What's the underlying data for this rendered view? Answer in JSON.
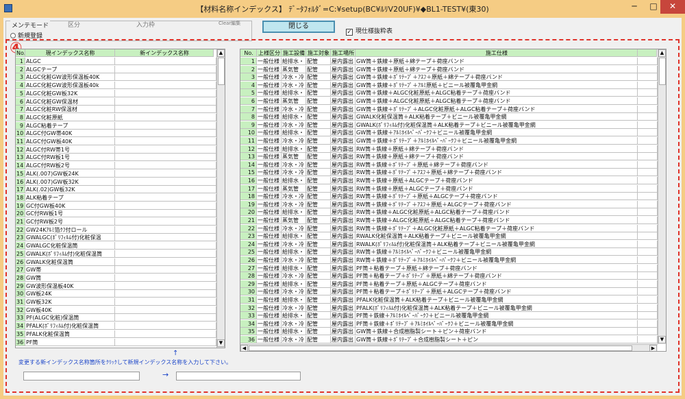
{
  "window": {
    "title": "【材料名称インデックス】 ﾃﾞｰﾀﾌｫﾙﾀﾞ=C:¥setup(BC¥ﾙﾘV20UF)¥◆BL1-TEST¥(東30)",
    "min": "─",
    "max": "□",
    "close": "✕"
  },
  "mode": {
    "group_label": "メンテモード",
    "options": [
      "新規登録",
      "区分",
      "入力枠",
      "Clear編集"
    ]
  },
  "close_button": "閉じる",
  "checkbox": {
    "label": "現仕様抜粋表",
    "checked": true,
    "mark": "✓"
  },
  "marker": "④",
  "left_table": {
    "headers": [
      "No.",
      "現インデックス名称",
      "新インデックス名称"
    ],
    "rows": [
      [
        "1",
        "ALGC"
      ],
      [
        "2",
        "ALGCテープ"
      ],
      [
        "3",
        "ALGC化粧GW波形保温板40K"
      ],
      [
        "4",
        "ALGC化粧GW波形保温板40k"
      ],
      [
        "5",
        "ALGC化粧GW板32K"
      ],
      [
        "6",
        "ALGC化粧GW保温材"
      ],
      [
        "7",
        "ALGC化粧RW保温材"
      ],
      [
        "8",
        "ALGC化粧原紙"
      ],
      [
        "9",
        "ALGC粘着テープ"
      ],
      [
        "10",
        "ALGC付GW帯40K"
      ],
      [
        "11",
        "ALGC付GW板40K"
      ],
      [
        "12",
        "ALGC付RW帯1号"
      ],
      [
        "13",
        "ALGC付RW板1号"
      ],
      [
        "14",
        "ALGC付RW板2号"
      ],
      [
        "15",
        "ALK(.007)GW板24K"
      ],
      [
        "16",
        "ALK(.007)GW板32K"
      ],
      [
        "17",
        "ALK(.02)GW板32K"
      ],
      [
        "18",
        "ALK粘着テープ"
      ],
      [
        "19",
        "GC付GW板40K"
      ],
      [
        "20",
        "GC付RW板1号"
      ],
      [
        "21",
        "GC付RW板2号"
      ],
      [
        "22",
        "GW24Kｱﾙﾐ箔ｸﾌ付ロール"
      ],
      [
        "23",
        "GWALGC(ﾎﾟﾘﾌｨﾙﾑ付)化粧保温"
      ],
      [
        "24",
        "GWALGC化粧保温筒"
      ],
      [
        "25",
        "GWALK(ﾎﾟﾘﾌｨﾙﾑ付)化粧保温筒"
      ],
      [
        "26",
        "GWALK化粧保温筒"
      ],
      [
        "27",
        "GW帯"
      ],
      [
        "28",
        "GW筒"
      ],
      [
        "29",
        "GW波形保温板40K"
      ],
      [
        "30",
        "GW板24K"
      ],
      [
        "31",
        "GW板32K"
      ],
      [
        "32",
        "GW板40K"
      ],
      [
        "33",
        "PF(ALGC化粧)保温筒"
      ],
      [
        "34",
        "PFALK(ﾎﾟﾘﾌｨﾙﾑ付)化粧保温筒"
      ],
      [
        "35",
        "PFALK化粧保温筒"
      ],
      [
        "36",
        "PF筒"
      ]
    ],
    "scroll_up": "▲",
    "scroll_down": "▼"
  },
  "right_table": {
    "headers": [
      "No.",
      "上様区分",
      "施工設備",
      "施工対象",
      "施工場所",
      "施工仕様"
    ],
    "rows": [
      [
        "1",
        "一般仕様",
        "給排水・",
        "配管",
        "屋内露出",
        "GW筒＋鉄線＋原紙＋綿テープ＋荷座バンド"
      ],
      [
        "2",
        "一般仕様",
        "蒸気管",
        "配管",
        "屋内露出",
        "GW筒＋鉄線＋原紙＋綿テープ＋荷座バンド"
      ],
      [
        "3",
        "一般仕様",
        "冷水・冷",
        "配管",
        "屋内露出",
        "GW筒＋鉄線＋ﾎﾟﾘﾃｰﾌﾟ＋ｱｽﾌ＋原紙＋綿テープ＋荷座バンド"
      ],
      [
        "4",
        "一般仕様",
        "冷水・冷",
        "配管",
        "屋内露出",
        "GW筒＋鉄線＋ﾎﾟﾘﾃｰﾌﾟ＋ｱﾙﾐ原紙＋ビニール被覆亀甲金網"
      ],
      [
        "5",
        "一般仕様",
        "給排水・",
        "配管",
        "屋内露出",
        "GW筒＋鉄線＋ALGC化粧原紙＋ALGC粘着テープ＋荷座バンド"
      ],
      [
        "6",
        "一般仕様",
        "蒸気管",
        "配管",
        "屋内露出",
        "GW筒＋鉄線＋ALGC化粧原紙＋ALGC粘着テープ＋荷座バンド"
      ],
      [
        "7",
        "一般仕様",
        "冷水・冷",
        "配管",
        "屋内露出",
        "GW筒＋鉄線＋ﾎﾟﾘﾃｰﾌﾟ＋ALGC化粧原紙＋ALGC粘着テープ＋荷座バンド"
      ],
      [
        "8",
        "一般仕様",
        "給排水・",
        "配管",
        "屋内露出",
        "GWALK化粧保温筒＋ALK粘着テープ＋ビニール被覆亀甲金網"
      ],
      [
        "9",
        "一般仕様",
        "冷水・冷",
        "配管",
        "屋内露出",
        "GWALK(ﾎﾟﾘﾌｨﾙﾑ付)化粧保温筒＋ALK粘着テープ＋ビニール被覆亀甲金網"
      ],
      [
        "10",
        "一般仕様",
        "給排水・",
        "配管",
        "屋内露出",
        "GW筒＋鉄線＋ｱﾙﾐﾎｲﾙﾍﾟｰﾊﾟｰｸﾌ＋ビニール被覆亀甲金網"
      ],
      [
        "11",
        "一般仕様",
        "冷水・冷",
        "配管",
        "屋内露出",
        "GW筒＋鉄線＋ﾎﾟﾘﾃｰﾌﾟ＋ｱﾙﾐﾎｲﾙﾍﾟｰﾊﾟｰｸﾌ＋ビニール被覆亀甲金網"
      ],
      [
        "12",
        "一般仕様",
        "給排水・",
        "配管",
        "屋内露出",
        "RW筒＋鉄線＋原紙＋綿テープ＋荷座バンド"
      ],
      [
        "13",
        "一般仕様",
        "蒸気管",
        "配管",
        "屋内露出",
        "RW筒＋鉄線＋原紙＋綿テープ＋荷座バンド"
      ],
      [
        "14",
        "一般仕様",
        "冷水・冷",
        "配管",
        "屋内露出",
        "RW筒＋鉄線＋ﾎﾟﾘﾃｰﾌﾟ＋原紙＋綿テープ＋荷座バンド"
      ],
      [
        "15",
        "一般仕様",
        "冷水・冷",
        "配管",
        "屋内露出",
        "RW筒＋鉄線＋ﾎﾟﾘﾃｰﾌﾟ＋ｱｽﾌ＋原紙＋綿テープ＋荷座バンド"
      ],
      [
        "16",
        "一般仕様",
        "給排水・",
        "配管",
        "屋内露出",
        "RW筒＋鉄線＋原紙＋ALGCテープ＋荷座バンド"
      ],
      [
        "17",
        "一般仕様",
        "蒸気管",
        "配管",
        "屋内露出",
        "RW筒＋鉄線＋原紙＋ALGCテープ＋荷座バンド"
      ],
      [
        "18",
        "一般仕様",
        "冷水・冷",
        "配管",
        "屋内露出",
        "RW筒＋鉄線＋ﾎﾟﾘﾃｰﾌﾟ＋原紙＋ALGCテープ＋荷座バンド"
      ],
      [
        "19",
        "一般仕様",
        "冷水・冷",
        "配管",
        "屋内露出",
        "RW筒＋鉄線＋ﾎﾟﾘﾃｰﾌﾟ＋ｱｽﾌ＋原紙＋ALGCテープ＋荷座バンド"
      ],
      [
        "20",
        "一般仕様",
        "給排水・",
        "配管",
        "屋内露出",
        "RW筒＋鉄線＋ALGC化粧原紙＋ALGC粘着テープ＋荷座バンド"
      ],
      [
        "21",
        "一般仕様",
        "蒸気管",
        "配管",
        "屋内露出",
        "RW筒＋鉄線＋ALGC化粧原紙＋ALGC粘着テープ＋荷座バンド"
      ],
      [
        "22",
        "一般仕様",
        "冷水・冷",
        "配管",
        "屋内露出",
        "RW筒＋鉄線＋ﾎﾟﾘﾃｰﾌﾟ＋ALGC化粧原紙＋ALGC粘着テープ＋荷座バンド"
      ],
      [
        "23",
        "一般仕様",
        "給排水・",
        "配管",
        "屋内露出",
        "RWALK化粧保温筒＋ALK粘着テープ＋ビニール被覆亀甲金網"
      ],
      [
        "24",
        "一般仕様",
        "冷水・冷",
        "配管",
        "屋内露出",
        "RWALK(ﾎﾟﾘﾌｨﾙﾑ付)化粧保温筒＋ALK粘着テープ＋ビニール被覆亀甲金網"
      ],
      [
        "25",
        "一般仕様",
        "給排水・",
        "配管",
        "屋内露出",
        "RW筒＋鉄線＋ｱﾙﾐﾎｲﾙﾍﾟｰﾊﾟｰｸﾌ＋ビニール被覆亀甲金網"
      ],
      [
        "26",
        "一般仕様",
        "冷水・冷",
        "配管",
        "屋内露出",
        "RW筒＋鉄線＋ﾎﾟﾘﾃｰﾌﾟ＋ｱﾙﾐﾎｲﾙﾍﾟｰﾊﾟｰｸﾌ＋ビニール被覆亀甲金網"
      ],
      [
        "27",
        "一般仕様",
        "給排水・",
        "配管",
        "屋内露出",
        "PF筒＋粘着テープ＋原紙＋綿テープ＋荷座バンド"
      ],
      [
        "28",
        "一般仕様",
        "冷水・冷",
        "配管",
        "屋内露出",
        "PF筒＋粘着テープ＋ﾎﾟﾘﾃｰﾌﾟ＋原紙＋綿テープ＋荷座バンド"
      ],
      [
        "29",
        "一般仕様",
        "給排水・",
        "配管",
        "屋内露出",
        "PF筒＋粘着テープ＋原紙＋ALGCテープ＋荷座バンド"
      ],
      [
        "30",
        "一般仕様",
        "冷水・冷",
        "配管",
        "屋内露出",
        "PF筒＋粘着テープ＋ﾎﾟﾘﾃｰﾌﾟ＋原紙＋ALGCテープ＋荷座バンド"
      ],
      [
        "31",
        "一般仕様",
        "給排水・",
        "配管",
        "屋内露出",
        "PFALK化粧保温筒＋ALK粘着テープ＋ビニール被覆亀甲金網"
      ],
      [
        "32",
        "一般仕様",
        "冷水・冷",
        "配管",
        "屋内露出",
        "PFALK(ﾎﾟﾘﾌｨﾙﾑ付)化粧保温筒＋ALK粘着テープ＋ビニール被覆亀甲金網"
      ],
      [
        "33",
        "一般仕様",
        "給排水・",
        "配管",
        "屋内露出",
        "PF筒＋鉄線＋ｱﾙﾐﾎｲﾙﾍﾟｰﾊﾟｰｸﾌ＋ビニール被覆亀甲金網"
      ],
      [
        "34",
        "一般仕様",
        "冷水・冷",
        "配管",
        "屋内露出",
        "PF筒＋鉄線＋ﾎﾟﾘﾃｰﾌﾟ＋ｱﾙﾐﾎｲﾙﾍﾟｰﾊﾟｰｸﾌ＋ビニール被覆亀甲金網"
      ],
      [
        "35",
        "一般仕様",
        "給排水・",
        "配管",
        "屋内露出",
        "GW筒＋鉄線＋合成樹脂製シート＋ピン＋荷座バンド"
      ],
      [
        "36",
        "一般仕様",
        "冷水・冷",
        "配管",
        "屋内露出",
        "GW筒＋鉄線＋ﾎﾟﾘﾃｰﾌﾟ＋合成樹脂製シート＋ピン"
      ]
    ],
    "scroll_up": "▲",
    "scroll_down": "▼",
    "scroll_left": "◀",
    "scroll_right": "▶"
  },
  "hint": "変更する新インデックス名称箇所をｸﾘｯｸして新規インデックス名称を入力して下さい。",
  "arrow_up": "↑",
  "arrow_right": "→",
  "fields": {
    "current_value": "",
    "new_value": ""
  }
}
